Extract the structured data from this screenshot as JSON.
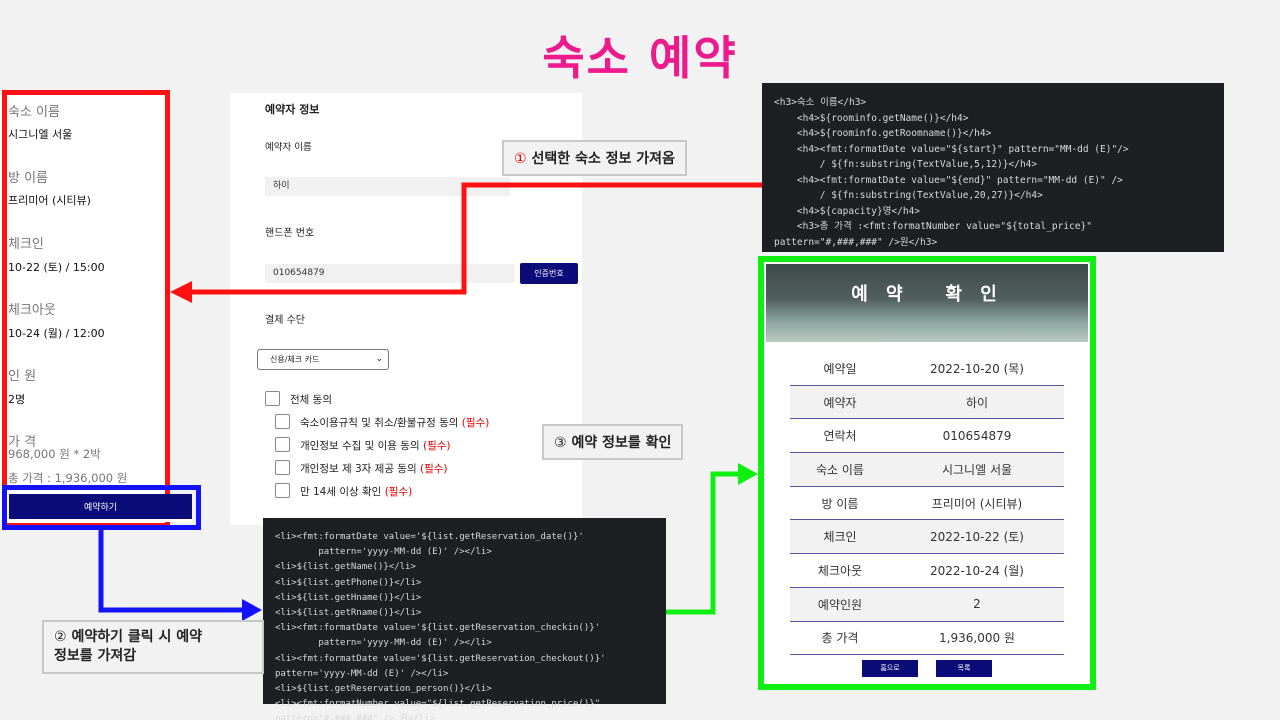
{
  "title": "숙소 예약",
  "left_panel": {
    "hotel_label": "숙소 이름",
    "hotel_value": "시그니엘 서울",
    "room_label": "방 이름",
    "room_value": "프리미어 (시티뷰)",
    "checkin_label": "체크인",
    "checkin_value": "10-22 (토) / 15:00",
    "checkout_label": "체크아웃",
    "checkout_value": "10-24 (월) / 12:00",
    "people_label": "인 원",
    "people_value": "2명",
    "price_label": "가 격",
    "price_value": "968,000 원 * 2박",
    "total_value": "총 가격 : 1,936,000 원",
    "reserve_button": "예약하기"
  },
  "form": {
    "section_title": "예약자 정보",
    "name_label": "예약자 이름",
    "name_value": "하이",
    "phone_label": "핸드폰 번호",
    "phone_value": "010654879",
    "auth_button": "인증번호",
    "payment_label": "결제 수단",
    "payment_selected": "신용/체크 카드",
    "agree_all": "전체 동의",
    "terms": [
      {
        "text": "숙소이용규칙 및 취소/환불규정 동의",
        "req": "(필수)"
      },
      {
        "text": "개인정보 수집 및 이용 동의",
        "req": "(필수)"
      },
      {
        "text": "개인정보 제 3자 제공 동의",
        "req": "(필수)"
      },
      {
        "text": "만 14세 이상 확인",
        "req": "(필수)"
      }
    ]
  },
  "callouts": {
    "c1_num": "①",
    "c1_text": "선택한 숙소 정보 가져옴",
    "c2_num": "②",
    "c2_text1": "예약하기 클릭 시 예약",
    "c2_text2": "정보를 가져감",
    "c3_num": "③",
    "c3_text": "예약 정보를 확인"
  },
  "code_top": [
    "<h3>숙소 이름</h3>",
    "    <h4>${roominfo.getName()}</h4>",
    "    <h4>${roominfo.getRoomname()}</h4>",
    "    <h4><fmt:formatDate value=\"${start}\" pattern=\"MM-dd (E)\"/>",
    "        / ${fn:substring(TextValue,5,12)}</h4>",
    "    <h4><fmt:formatDate value=\"${end}\" pattern=\"MM-dd (E)\" />",
    "        / ${fn:substring(TextValue,20,27)}</h4>",
    "    <h4>${capacity}명</h4>",
    "    <h3>총 가격 :<fmt:formatNumber value=\"${total_price}\"",
    "pattern=\"#,###,###\" />원</h3>"
  ],
  "code_bottom": [
    "<li><fmt:formatDate value='${list.getReservation_date()}'",
    "        pattern='yyyy-MM-dd (E)' /></li>",
    "<li>${list.getName()}</li>",
    "<li>${list.getPhone()}</li>",
    "<li>${list.getHname()}</li>",
    "<li>${list.getRname()}</li>",
    "<li><fmt:formatDate value='${list.getReservation_checkin()}'",
    "        pattern='yyyy-MM-dd (E)' /></li>",
    "<li><fmt:formatDate value='${list.getReservation_checkout()}'",
    "pattern='yyyy-MM-dd (E)' /></li>",
    "<li>${list.getReservation_person()}</li>",
    "<li><fmt:formatNumber value=\"${list.getReservation_price()}\"",
    "pattern=\"#,###,###\" /> 원</li>"
  ],
  "confirm": {
    "title": "예 약   확 인",
    "rows": [
      {
        "k": "예약일",
        "v": "2022-10-20 (목)"
      },
      {
        "k": "예약자",
        "v": "하이"
      },
      {
        "k": "연락처",
        "v": "010654879"
      },
      {
        "k": "숙소 이름",
        "v": "시그니엘 서울"
      },
      {
        "k": "방 이름",
        "v": "프리미어 (시티뷰)"
      },
      {
        "k": "체크인",
        "v": "2022-10-22 (토)"
      },
      {
        "k": "체크아웃",
        "v": "2022-10-24 (월)"
      },
      {
        "k": "예약인원",
        "v": "2"
      },
      {
        "k": "총 가격",
        "v": "1,936,000 원"
      }
    ],
    "home_button": "홈으로",
    "list_button": "목록"
  },
  "colors": {
    "title": "#ec1a8c",
    "red_frame": "#ff1111",
    "blue_frame": "#1212ff",
    "green_frame": "#11ee11",
    "button_navy": "#0b0b7a"
  }
}
